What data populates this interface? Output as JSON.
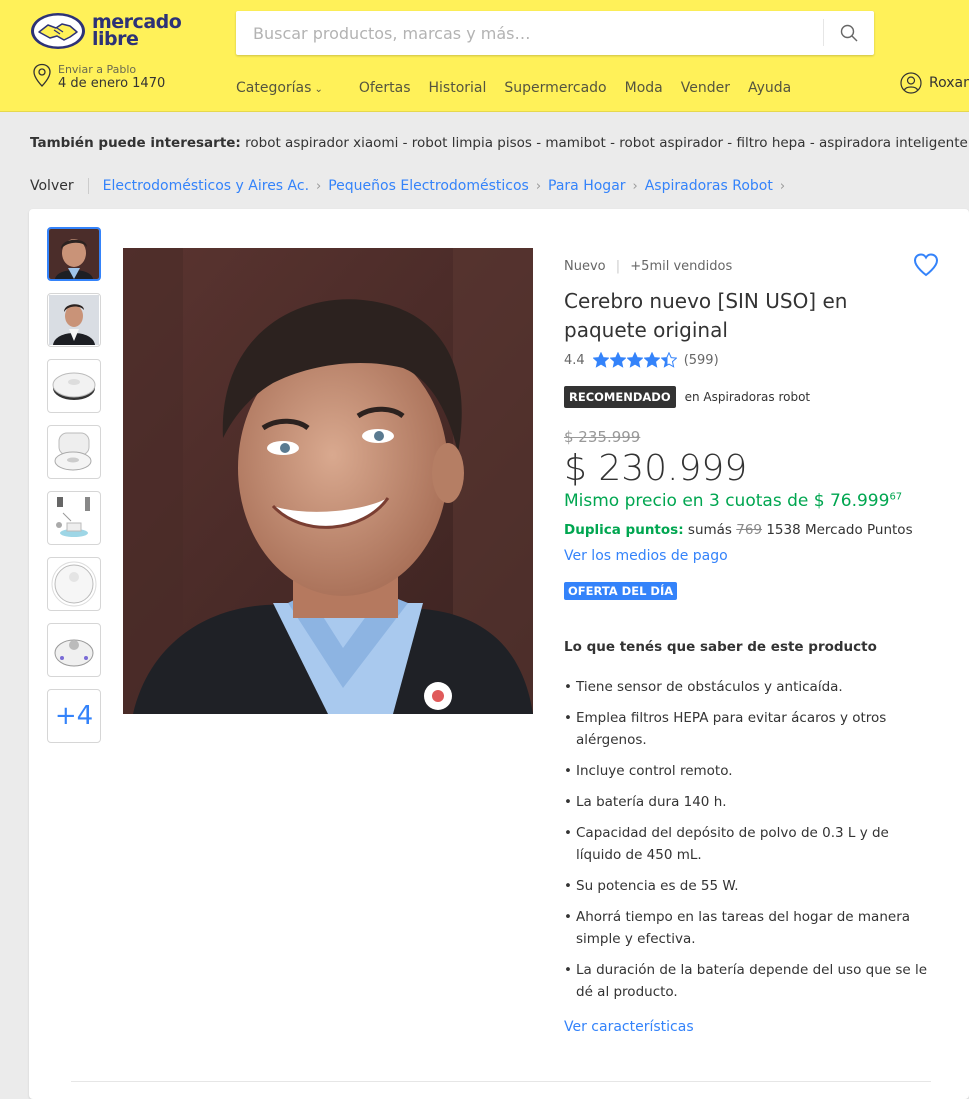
{
  "header": {
    "logo_text_line1": "mercado",
    "logo_text_line2": "libre",
    "search_placeholder": "Buscar productos, marcas y más…",
    "location_label": "Enviar a Pablo",
    "location_value": "4 de enero 1470",
    "nav": [
      "Categorías",
      "Ofertas",
      "Historial",
      "Supermercado",
      "Moda",
      "Vender",
      "Ayuda"
    ],
    "user_name": "Roxana",
    "colors": {
      "bar": "#fff159",
      "brand": "#2d3277"
    }
  },
  "related": {
    "label": "También puede interesarte:",
    "items": "robot aspirador xiaomi - robot limpia pisos - mamibot - robot aspirador - filtro hepa - aspiradora inteligente"
  },
  "breadcrumb": {
    "back": "Volver",
    "items": [
      "Electrodomésticos y Aires Ac.",
      "Pequeños Electrodomésticos",
      "Para Hogar",
      "Aspiradoras Robot"
    ]
  },
  "gallery": {
    "thumbnails": [
      "portrait-man-smiling",
      "portrait-man-suit",
      "robot-vacuum-top",
      "robot-vacuum-base",
      "robot-vacuum-accessories",
      "robot-vacuum-white",
      "robot-vacuum-angle"
    ],
    "more_label": "+4"
  },
  "product": {
    "condition": "Nuevo",
    "sold": "+5mil vendidos",
    "title": "Cerebro nuevo [SIN USO] en paquete original",
    "rating": "4.4",
    "rating_value": 4.4,
    "reviews": "(599)",
    "badge": "RECOMENDADO",
    "badge_context": "en Aspiradoras robot",
    "old_price": "$ 235.999",
    "price": "$ 230.999",
    "installments_text": "Mismo precio en 3 cuotas de $ 76.999",
    "installments_cents": "67",
    "points_label": "Duplica puntos:",
    "points_text_pre": "sumás",
    "points_old": "769",
    "points_text_post": "1538 Mercado Puntos",
    "payment_link": "Ver los medios de pago",
    "deal_badge": "OFERTA DEL DÍA",
    "know_title": "Lo que tenés que saber de este producto",
    "features": [
      "Tiene sensor de obstáculos y anticaída.",
      "Emplea filtros HEPA para evitar ácaros y otros alérgenos.",
      "Incluye control remoto.",
      "La batería dura 140 h.",
      "Capacidad del depósito de polvo de 0.3 L y de líquido de 450 mL.",
      "Su potencia es de 55 W.",
      "Ahorrá tiempo en las tareas del hogar de manera simple y efectiva.",
      "La duración de la batería depende del uso que se le dé al producto."
    ],
    "characteristics_link": "Ver características",
    "colors": {
      "link": "#3483fa",
      "green": "#00a650"
    }
  }
}
